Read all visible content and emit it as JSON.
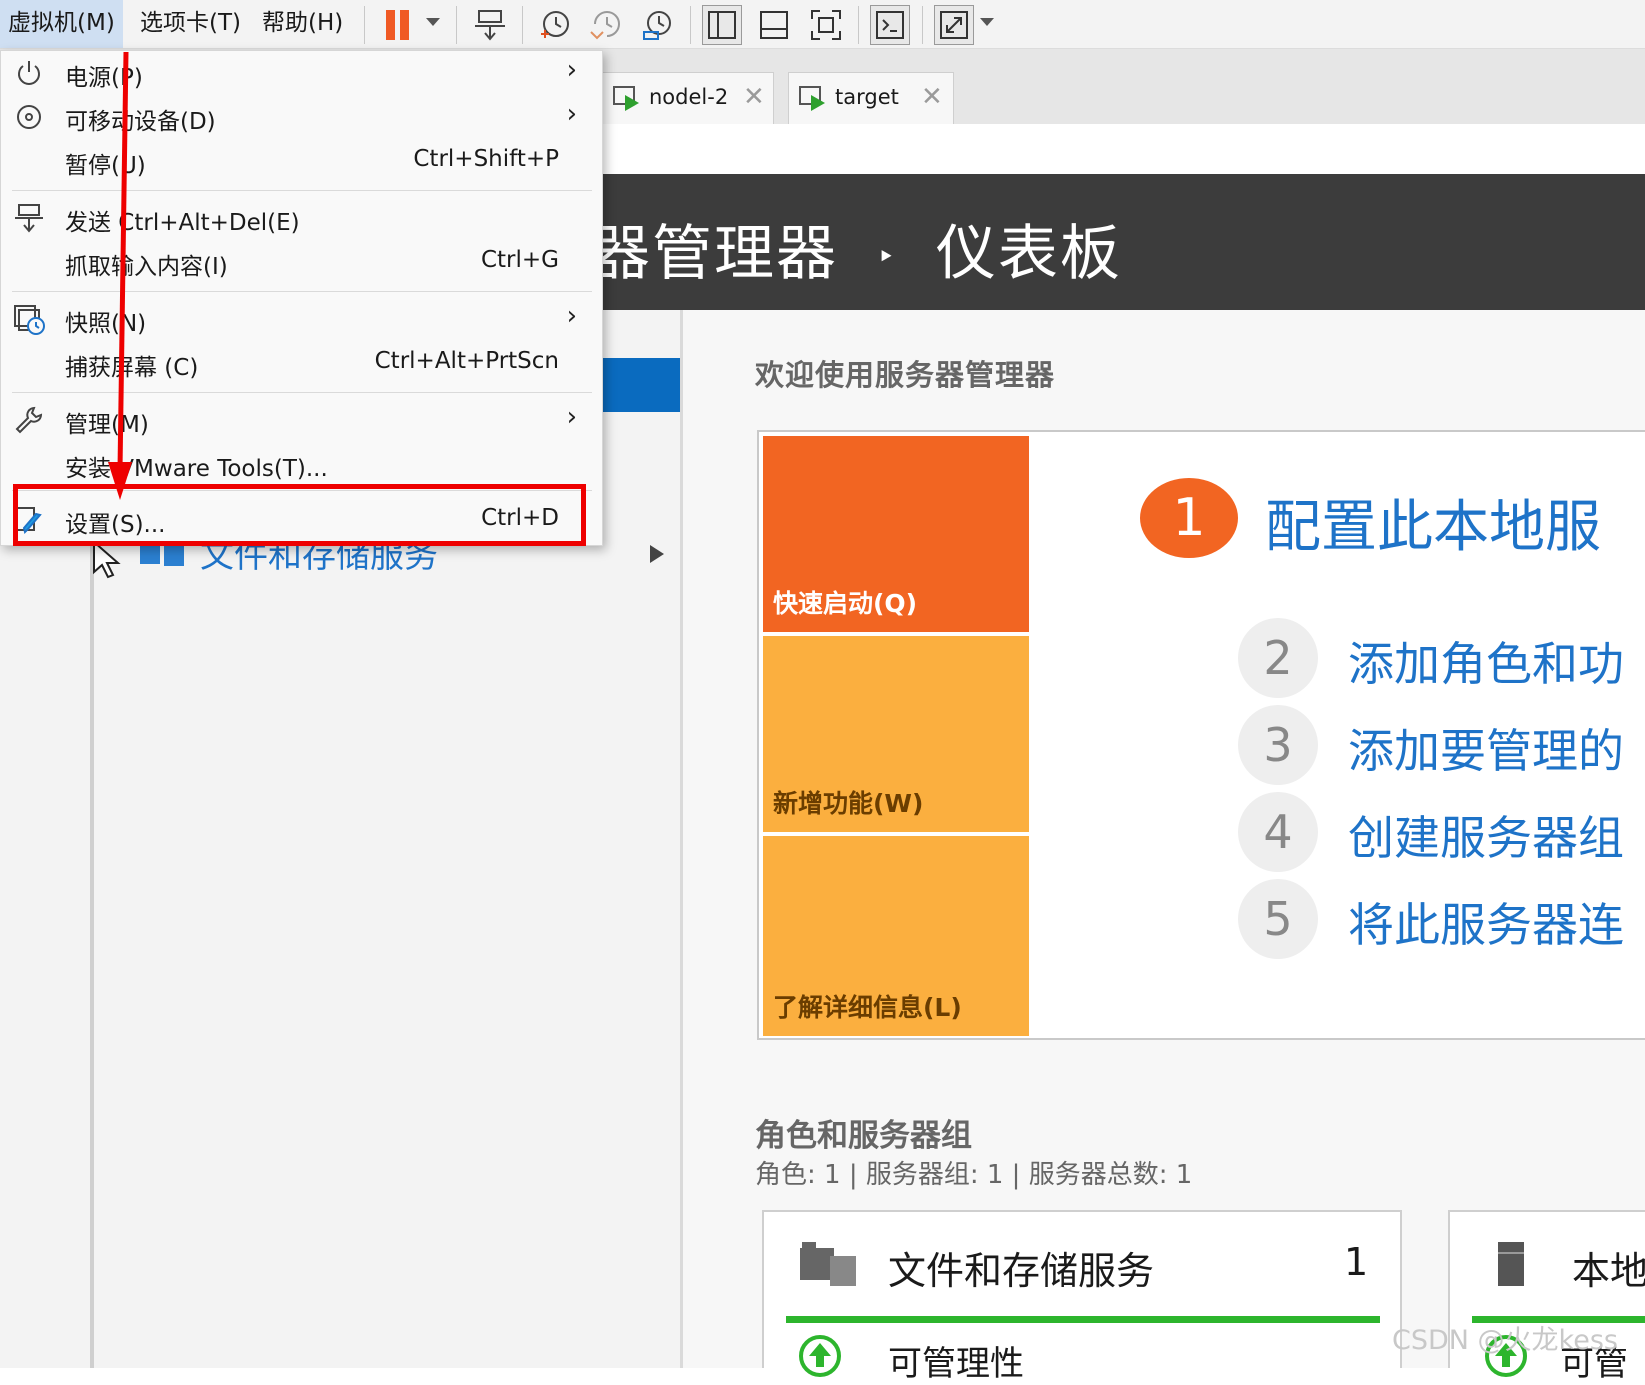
{
  "menubar": {
    "items": [
      {
        "label": "虚拟机(M)",
        "active": true
      },
      {
        "label": "选项卡(T)",
        "active": false
      },
      {
        "label": "帮助(H)",
        "active": false
      }
    ]
  },
  "toolbar": {
    "icons": [
      "pause-icon",
      "dropdown-caret-icon",
      "send-ctrl-alt-del-icon",
      "take-snapshot-icon",
      "revert-snapshot-icon",
      "snapshot-manager-icon",
      "show-library-icon",
      "show-thumbnail-icon",
      "full-screen-icon",
      "console-view-icon",
      "stretch-guest-icon",
      "dropdown-caret-icon"
    ],
    "pause_color": "#f05a24"
  },
  "tabs": [
    {
      "label": "nodel-2"
    },
    {
      "label": "target"
    }
  ],
  "vm_menu": {
    "items": [
      {
        "label": "电源(P)",
        "shortcut": "",
        "submenu": true,
        "icon": "power-icon"
      },
      {
        "label": "可移动设备(D)",
        "shortcut": "",
        "submenu": true,
        "icon": "removable-device-icon"
      },
      {
        "label": "暂停(U)",
        "shortcut": "Ctrl+Shift+P",
        "submenu": false,
        "icon": ""
      },
      {
        "label": "发送 Ctrl+Alt+Del(E)",
        "shortcut": "",
        "submenu": false,
        "icon": "send-keys-icon"
      },
      {
        "label": "抓取输入内容(I)",
        "shortcut": "Ctrl+G",
        "submenu": false,
        "icon": ""
      },
      {
        "label": "快照(N)",
        "shortcut": "",
        "submenu": true,
        "icon": "snapshot-icon"
      },
      {
        "label": "捕获屏幕 (C)",
        "shortcut": "Ctrl+Alt+PrtScn",
        "submenu": false,
        "icon": ""
      },
      {
        "label": "管理(M)",
        "shortcut": "",
        "submenu": true,
        "icon": "wrench-icon"
      },
      {
        "label": "安装 VMware Tools(T)...",
        "shortcut": "",
        "submenu": false,
        "icon": ""
      },
      {
        "label": "设置(S)...",
        "shortcut": "Ctrl+D",
        "submenu": false,
        "icon": "settings-icon"
      }
    ],
    "submenu_glyph": "›",
    "highlight_color": "#ee0000"
  },
  "server_manager": {
    "header_left": "器管理器",
    "header_sep": "‣",
    "header_right": "仪表板",
    "nav_files": "文件和存储服务",
    "welcome": "欢迎使用服务器管理器",
    "tiles": {
      "quick": "快速启动(Q)",
      "new": "新增功能(W)",
      "learn": "了解详细信息(L)"
    },
    "steps": [
      {
        "num": "1",
        "text": "配置此本地服"
      },
      {
        "num": "2",
        "text": "添加角色和功"
      },
      {
        "num": "3",
        "text": "添加要管理的"
      },
      {
        "num": "4",
        "text": "创建服务器组"
      },
      {
        "num": "5",
        "text": "将此服务器连"
      }
    ],
    "roles_title": "角色和服务器组",
    "roles_stats": "角色: 1 | 服务器组: 1 | 服务器总数: 1",
    "cards": [
      {
        "title": "文件和存储服务",
        "count": "1",
        "status": "可管理性"
      },
      {
        "title": "本地",
        "count": "",
        "status": "可管"
      }
    ],
    "colors": {
      "quick": "#f26522",
      "tile": "#fbaf3f",
      "link": "#1e73c8",
      "ok": "#2db52d"
    }
  },
  "watermark": "CSDN @火龙kess"
}
